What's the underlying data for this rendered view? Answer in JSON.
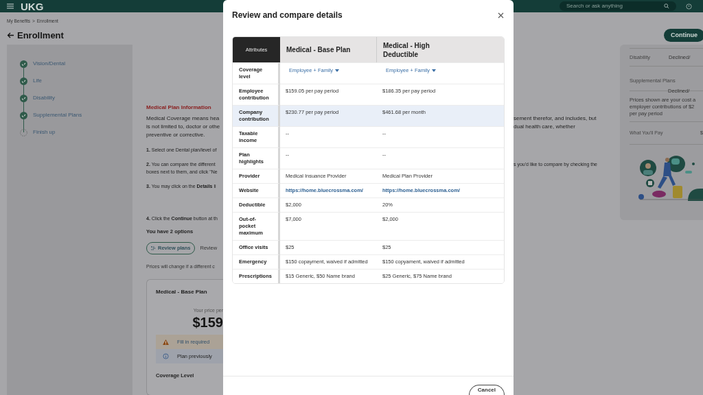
{
  "topbar": {
    "logo": "UKG",
    "search": {
      "placeholder": "Search or ask anything"
    }
  },
  "breadcrumb": {
    "items": [
      "My Benefits",
      "Enrollment"
    ],
    "separator": ">"
  },
  "page_title": "Enrollment",
  "continue_button": "Continue",
  "steps": [
    {
      "label": "Vision/Dental",
      "done": true
    },
    {
      "label": "Life",
      "done": true
    },
    {
      "label": "Disability",
      "done": true
    },
    {
      "label": "Supplemental Plans",
      "done": true
    },
    {
      "label": "Finish up",
      "done": false
    }
  ],
  "content": {
    "heading": "Medical Plan Information",
    "intro": {
      "left": "Medical Coverage means hea\nis not limited to, doctor or othe\npreventive or corrective.",
      "right": "sement therefor, and includes, but\ndual health care, whether"
    },
    "instructions": [
      {
        "left": "**1.** Select one Dental plan/level of"
      },
      {
        "left": "**2.** You can compare the different\nboxes next to them, and click \"Ne",
        "right": "s you'd like to compare by checking the"
      },
      {
        "left": "**3.** You may click on the **Details** li"
      },
      {
        "left": "**4.** Click the **Continue** button at th"
      }
    ],
    "options_title": "You have 2 options",
    "review_button": "Review plans",
    "review_link": "Review",
    "price_note": "Prices will change if a different c",
    "card": {
      "title": "Medical - Base Plan",
      "price_label": "Your price per",
      "price": "$159",
      "alerts": [
        {
          "kind": "warning",
          "text": "Fill in required"
        },
        {
          "kind": "info",
          "text": "Plan previously"
        }
      ],
      "coverage_label": "Coverage Level"
    }
  },
  "summary": {
    "rows": [
      {
        "label": "Disability",
        "value": "Declined/"
      },
      {
        "label": "Supplemental Plans",
        "value": "Declined/"
      }
    ],
    "note": "Prices shown are your cost a\nemployer contributions of $2\nper pay period",
    "total": {
      "label": "What You'll Pay",
      "value": "$"
    }
  },
  "modal": {
    "title": "Review and compare details",
    "attributes_header": "Attributes",
    "plans": [
      "Medical - Base Plan",
      "Medical - High Deductible"
    ],
    "rows": [
      {
        "attribute": "Coverage level",
        "kind": "dropdown",
        "values": [
          "Employee + Family",
          "Employee + Family"
        ],
        "selected": false
      },
      {
        "attribute": "Employee contribution",
        "kind": "text",
        "values": [
          "$159.05 per pay period",
          "$186.35 per pay period"
        ],
        "selected": false
      },
      {
        "attribute": "Company contribution",
        "kind": "text",
        "values": [
          "$230.77 per pay period",
          "$461.68 per month"
        ],
        "selected": true
      },
      {
        "attribute": "Taxable income",
        "kind": "text",
        "values": [
          "--",
          "--"
        ],
        "selected": false
      },
      {
        "attribute": "Plan highlights",
        "kind": "text",
        "values": [
          "--",
          "--"
        ],
        "selected": false
      },
      {
        "attribute": "Provider",
        "kind": "text",
        "values": [
          "Medical Insuance Provider",
          "Medical Plan Provider"
        ],
        "selected": false
      },
      {
        "attribute": "Website",
        "kind": "link",
        "values": [
          "https://home.bluecrossma.com/",
          "https://home.bluecrossma.com/"
        ],
        "selected": false
      },
      {
        "attribute": "Deductible",
        "kind": "text",
        "values": [
          "$2,000",
          "20%"
        ],
        "selected": false
      },
      {
        "attribute": "Out-of-pocket maximum",
        "kind": "text",
        "values": [
          "$7,000",
          "$2,000"
        ],
        "selected": false
      },
      {
        "attribute": "Office visits",
        "kind": "text",
        "values": [
          "$25",
          "$25"
        ],
        "selected": false
      },
      {
        "attribute": "Emergency",
        "kind": "text",
        "values": [
          "$150 copayment, waived if admitted",
          "$150 copyament, waived if admitted"
        ],
        "selected": false
      },
      {
        "attribute": "Prescriptions",
        "kind": "text",
        "values": [
          "$15 Generic, $50 Name brand",
          "$25 Generic, $75 Name brand"
        ],
        "selected": false
      }
    ],
    "cancel_button": "Cancel"
  }
}
